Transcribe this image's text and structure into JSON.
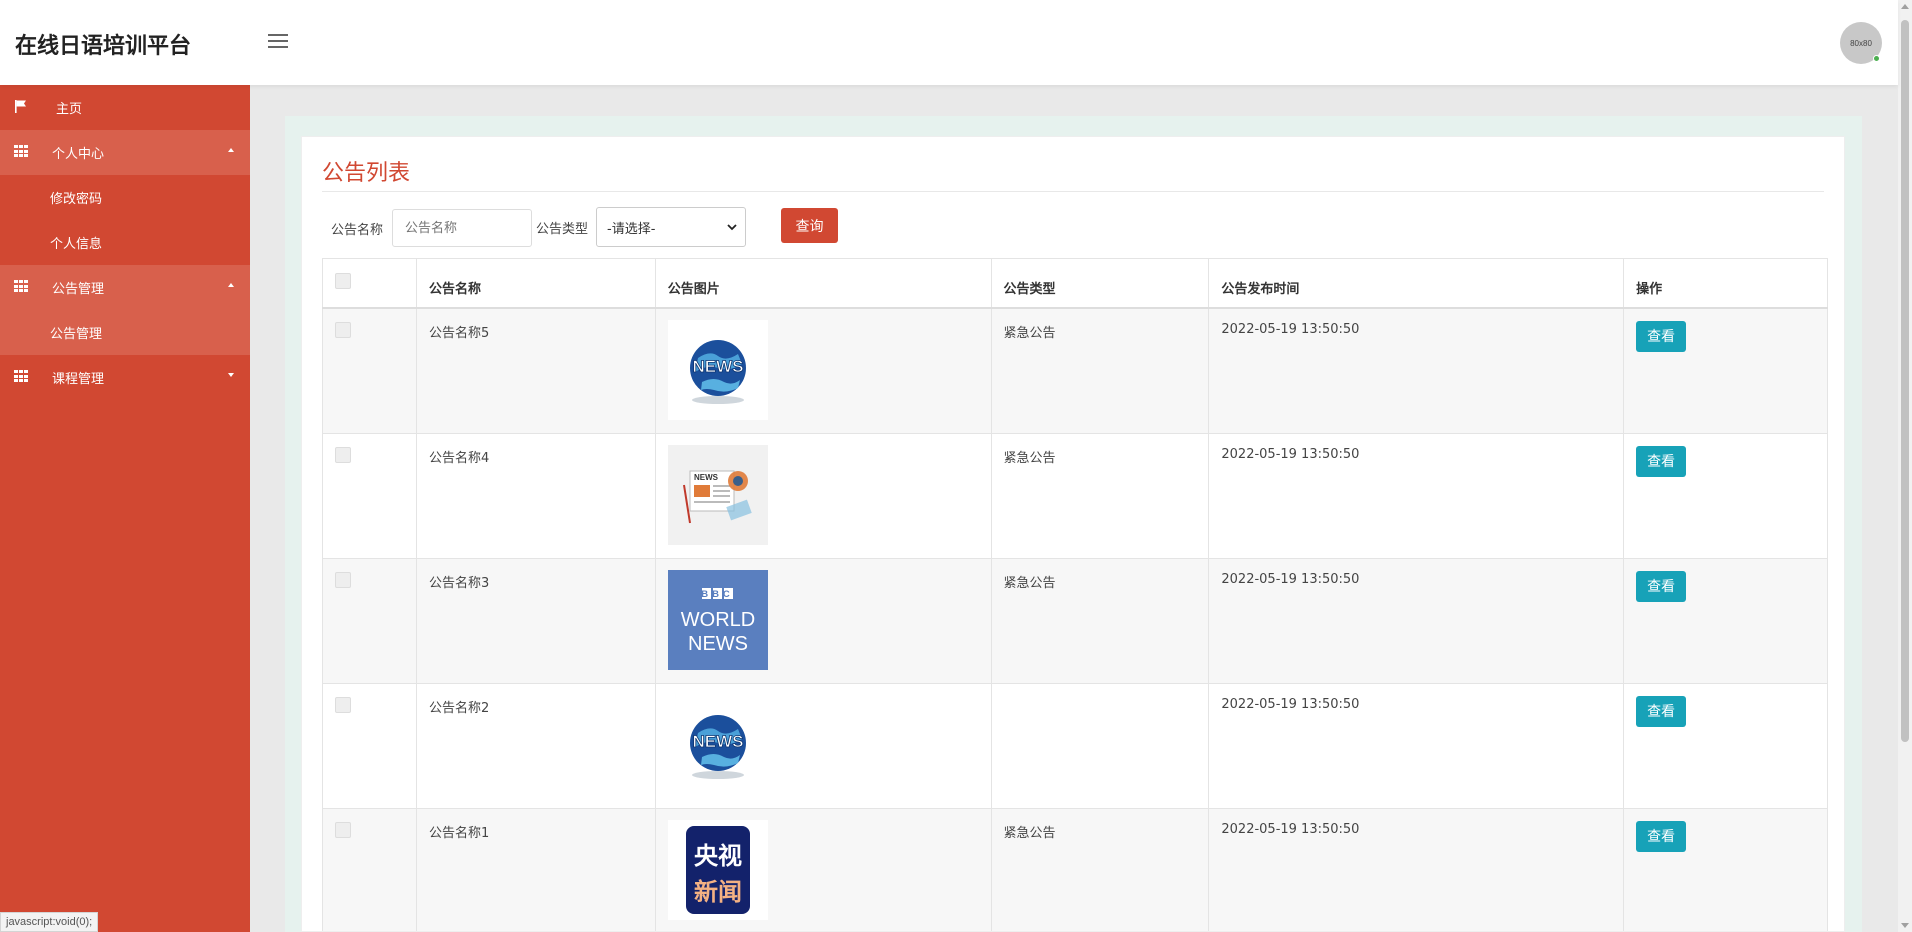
{
  "app": {
    "title": "在线日语培训平台"
  },
  "header": {
    "avatar_text": "80x80"
  },
  "sidebar": {
    "home": "主页",
    "personal_center": "个人中心",
    "change_password": "修改密码",
    "personal_info": "个人信息",
    "notice_mgmt": "公告管理",
    "notice_mgmt_sub": "公告管理",
    "course_mgmt": "课程管理"
  },
  "page": {
    "title": "公告列表"
  },
  "search": {
    "name_label": "公告名称",
    "name_placeholder": "公告名称",
    "type_label": "公告类型",
    "type_selected": "-请选择-",
    "query_button": "查询"
  },
  "table": {
    "headers": [
      "公告名称",
      "公告图片",
      "公告类型",
      "公告发布时间",
      "操作"
    ],
    "action_label": "查看",
    "rows": [
      {
        "name": "公告名称5",
        "image": "news-globe",
        "type": "紧急公告",
        "time": "2022-05-19 13:50:50"
      },
      {
        "name": "公告名称4",
        "image": "news-paper",
        "type": "紧急公告",
        "time": "2022-05-19 13:50:50"
      },
      {
        "name": "公告名称3",
        "image": "bbc-world-news",
        "type": "紧急公告",
        "time": "2022-05-19 13:50:50"
      },
      {
        "name": "公告名称2",
        "image": "news-globe",
        "type": "",
        "time": "2022-05-19 13:50:50"
      },
      {
        "name": "公告名称1",
        "image": "cctv-news",
        "type": "紧急公告",
        "time": "2022-05-19 13:50:50"
      }
    ]
  },
  "image_text": {
    "news": "NEWS",
    "bbc": "BBC",
    "world": "WORLD",
    "news2": "NEWS",
    "cctv_1": "央视",
    "cctv_2": "新闻"
  },
  "status_bar": "javascript:void(0);",
  "colors": {
    "primary": "#d14832",
    "info": "#17a2b8"
  }
}
